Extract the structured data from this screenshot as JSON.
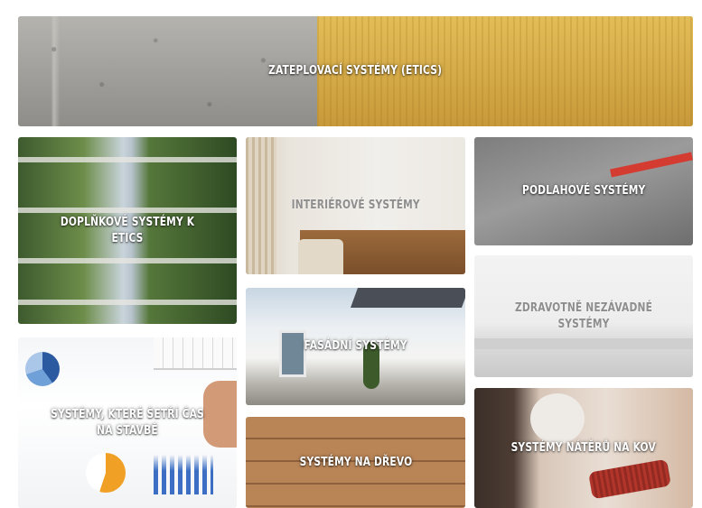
{
  "tiles": [
    {
      "id": "etics",
      "label": "ZATEPLOVACÍ SYSTÉMY (ETICS)"
    },
    {
      "id": "doplnkove",
      "label": "DOPLŇKOVÉ SYSTÉMY K ETICS"
    },
    {
      "id": "interier",
      "label": "INTERIÉROVÉ SYSTÉMY"
    },
    {
      "id": "podlahove",
      "label": "PODLAHOVÉ SYSTÉMY"
    },
    {
      "id": "zdravotne",
      "label": "ZDRAVOTNĚ NEZÁVADNÉ SYSTÉMY"
    },
    {
      "id": "fasadni",
      "label": "FASÁDNÍ SYSTÉMY"
    },
    {
      "id": "cas",
      "label": "SYSTÉMY, KTERÉ ŠETŘÍ ČAS NA STAVBĚ"
    },
    {
      "id": "drevo",
      "label": "SYSTÉMY NA DŘEVO"
    },
    {
      "id": "kov",
      "label": "SYSTÉMY NÁTĚRŮ NA KOV"
    }
  ]
}
